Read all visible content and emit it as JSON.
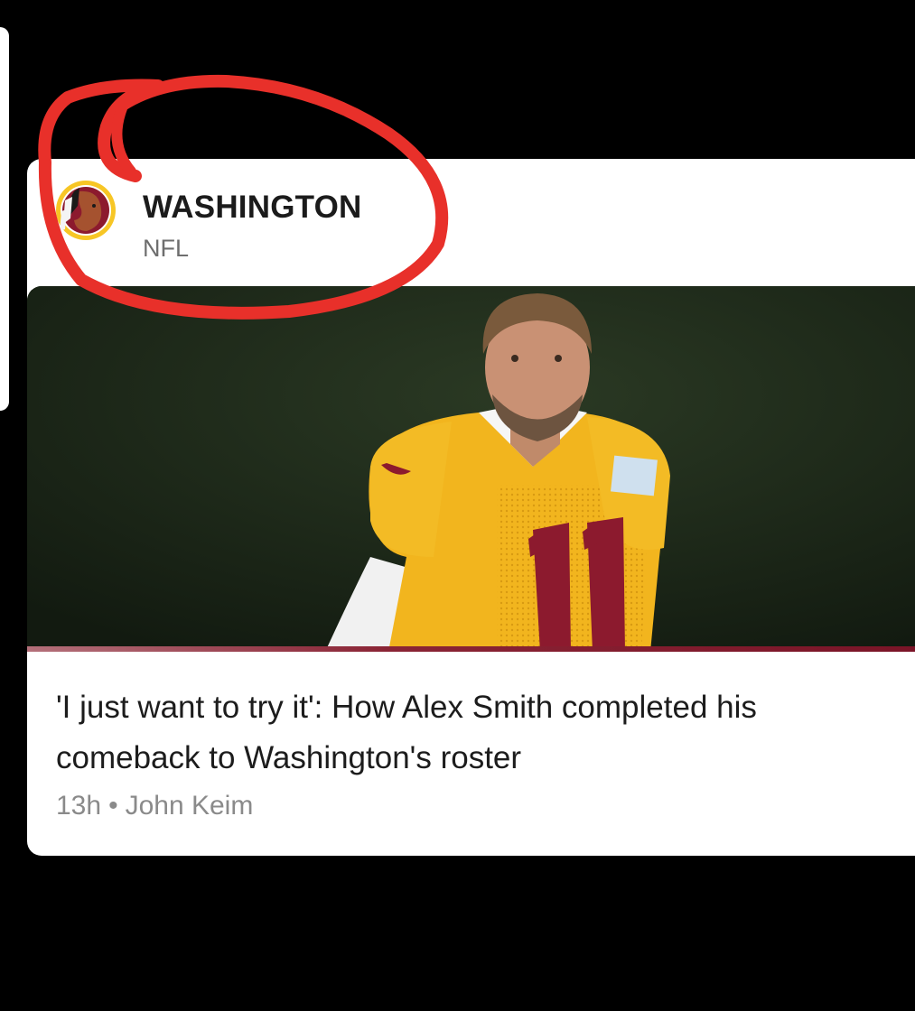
{
  "card": {
    "team_name": "WASHINGTON",
    "league": "NFL",
    "logo_icon": "redskins-logo-icon",
    "image": {
      "description_icon": "football-player-photo",
      "jersey_number": "11"
    },
    "headline": "'I just want to try it': How Alex Smith completed his comeback to Washington's roster",
    "time": "13h",
    "separator": "•",
    "author": "John Keim"
  },
  "colors": {
    "annotation": "#e8302a",
    "accent_stripe": "#7a1427",
    "jersey": "#f2b51e",
    "number": "#8c1a2e"
  }
}
